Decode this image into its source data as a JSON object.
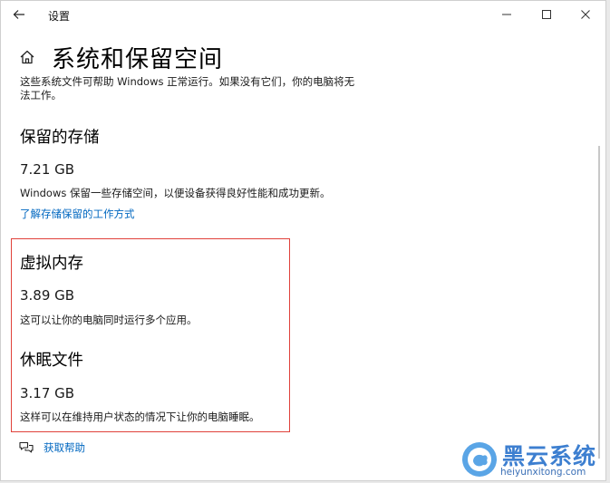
{
  "window": {
    "app_title": "设置",
    "icons": {
      "back": "back-arrow-icon",
      "minimize": "minimize-icon",
      "maximize": "maximize-icon",
      "close": "close-icon",
      "home": "home-icon",
      "help": "chat-bubbles-icon"
    }
  },
  "header": {
    "title": "系统和保留空间",
    "intro": "这些系统文件可帮助 Windows 正常运行。如果没有它们，你的电脑将无法工作。"
  },
  "reserved_storage": {
    "title": "保留的存储",
    "size": "7.21 GB",
    "description": "Windows 保留一些存储空间，以便设备获得良好性能和成功更新。",
    "link": "了解存储保留的工作方式"
  },
  "virtual_memory": {
    "title": "虚拟内存",
    "size": "3.89 GB",
    "description": "这可以让你的电脑同时运行多个应用。"
  },
  "hibernation_file": {
    "title": "休眠文件",
    "size": "3.17 GB",
    "description": "这样可以在维持用户状态的情况下让你的电脑睡眠。"
  },
  "help": {
    "label": "获取帮助"
  },
  "watermark": {
    "name": "黑云系统",
    "url": "heiyunxitong.com"
  },
  "colors": {
    "link": "#0067c0",
    "highlight_border": "#e0413a",
    "watermark": "#3d7fd0"
  }
}
